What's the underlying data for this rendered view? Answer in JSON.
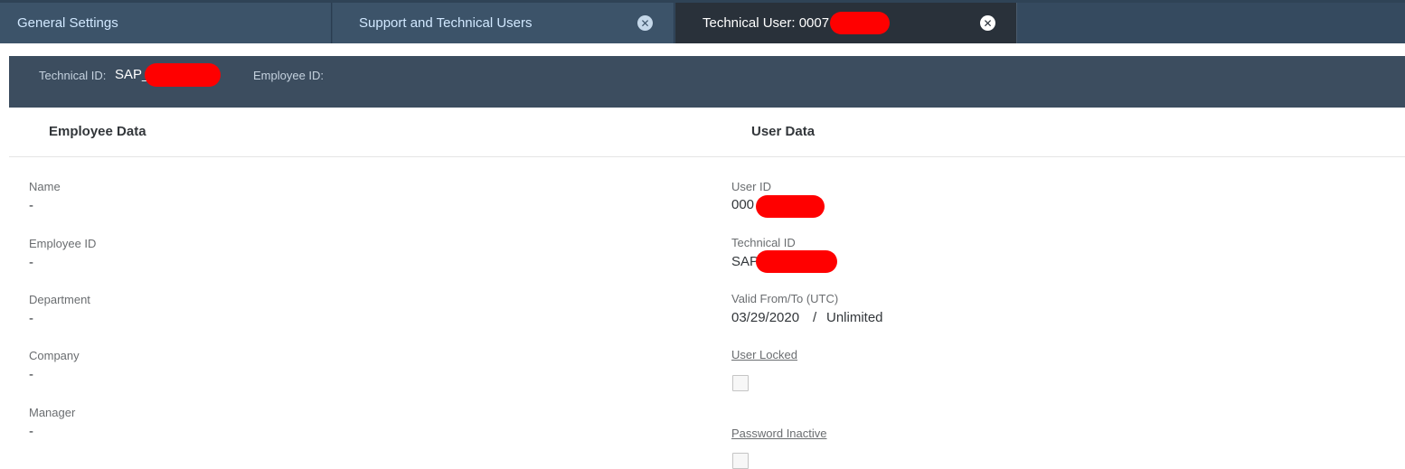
{
  "tabs": [
    {
      "label": "General Settings"
    },
    {
      "label": "Support and Technical Users",
      "close_icon": "close-circle-icon"
    },
    {
      "label": "Technical User: 0007",
      "close_icon": "close-circle-icon",
      "active": true
    }
  ],
  "header": {
    "technical_id_label": "Technical ID:",
    "technical_id_value": "SAP_",
    "employee_id_label": "Employee ID:",
    "employee_id_value": ""
  },
  "employee_data": {
    "title": "Employee Data",
    "fields": [
      {
        "label": "Name",
        "value": "-"
      },
      {
        "label": "Employee ID",
        "value": "-"
      },
      {
        "label": "Department",
        "value": "-"
      },
      {
        "label": "Company",
        "value": "-"
      },
      {
        "label": "Manager",
        "value": "-"
      }
    ]
  },
  "user_data": {
    "title": "User Data",
    "user_id_label": "User ID",
    "user_id_value": "000",
    "technical_id_label": "Technical ID",
    "technical_id_value": "SAP",
    "valid_label": "Valid From/To (UTC)",
    "valid_from": "03/29/2020",
    "valid_separator": "/",
    "valid_to": "Unlimited",
    "user_locked_label": "User Locked",
    "user_locked_checked": false,
    "password_inactive_label": "Password Inactive",
    "password_inactive_checked": false
  },
  "colors": {
    "shell": "#354a5f",
    "active_tab": "#29313a",
    "header_bar": "#3c4d5f",
    "redaction": "#ff0000"
  }
}
